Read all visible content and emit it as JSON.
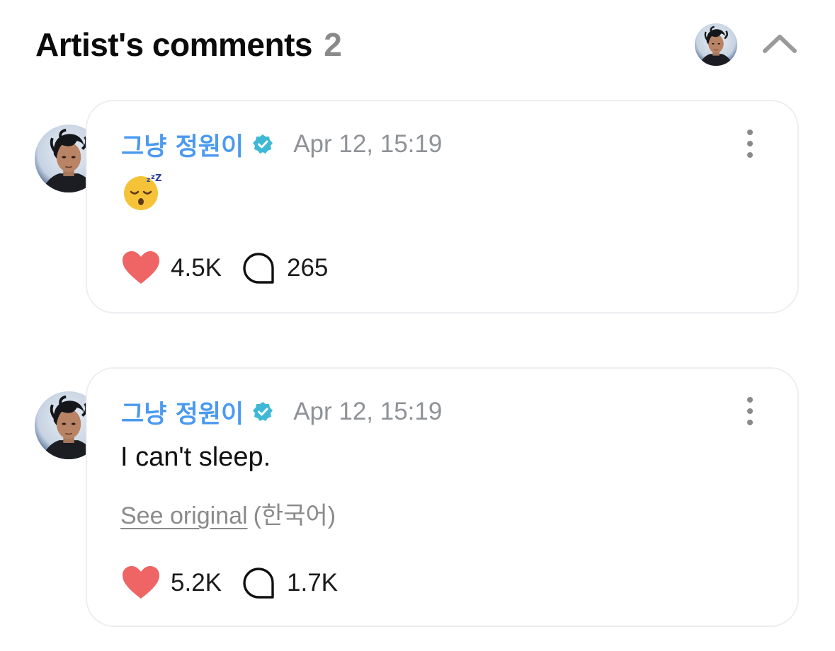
{
  "header": {
    "title": "Artist's comments",
    "count": "2"
  },
  "comments": [
    {
      "author": "그냥 정원이",
      "verified": true,
      "timestamp": "Apr 12, 15:19",
      "body_emoji": "sleeping-face-emoji",
      "likes": "4.5K",
      "replies": "265"
    },
    {
      "author": "그냥 정원이",
      "verified": true,
      "timestamp": "Apr 12, 15:19",
      "body_text": "I can't sleep.",
      "see_original": "See original",
      "original_language": "(한국어)",
      "likes": "5.2K",
      "replies": "1.7K"
    }
  ],
  "colors": {
    "author": "#4b9af0",
    "verified_badge": "#3fb8d6",
    "heart": "#ef6464",
    "timestamp": "#8f9297",
    "card_border": "#eceef1"
  },
  "icons": {
    "verified": "verified-badge-icon",
    "more": "more-vertical-icon",
    "like": "heart-icon",
    "reply": "speech-bubble-icon",
    "collapse": "chevron-up-icon"
  }
}
